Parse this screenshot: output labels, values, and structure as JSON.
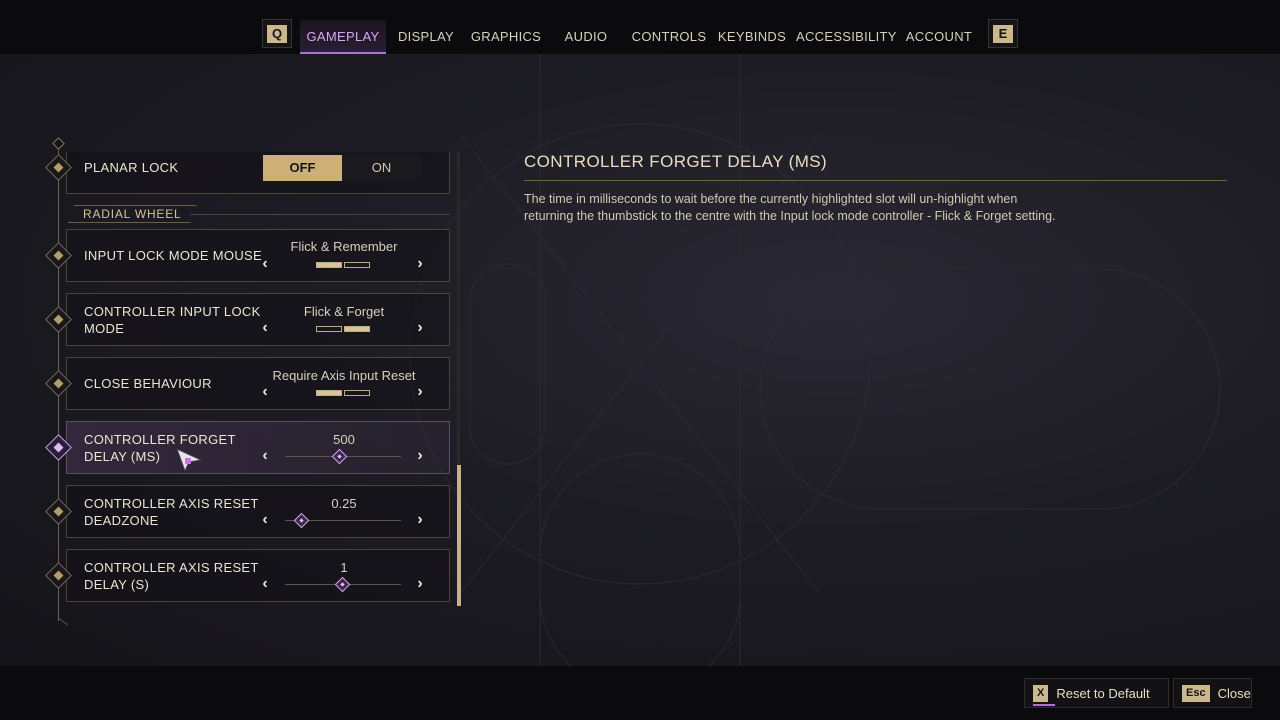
{
  "nav": {
    "prev_key": "Q",
    "next_key": "E",
    "tabs": [
      {
        "label": "GAMEPLAY",
        "active": true
      },
      {
        "label": "DISPLAY"
      },
      {
        "label": "GRAPHICS"
      },
      {
        "label": "AUDIO"
      },
      {
        "label": "CONTROLS"
      },
      {
        "label": "KEYBINDS"
      },
      {
        "label": "ACCESSIBILITY"
      },
      {
        "label": "ACCOUNT"
      }
    ]
  },
  "settings": {
    "planar_lock": {
      "label": "PLANAR LOCK",
      "off_label": "OFF",
      "on_label": "ON",
      "value": "OFF"
    },
    "section": "RADIAL WHEEL",
    "input_lock_mode_mouse": {
      "label": "INPUT LOCK MODE MOUSE",
      "value": "Flick & Remember",
      "option_index": 0,
      "option_count": 2
    },
    "controller_input_lock_mode": {
      "label_line1": "CONTROLLER INPUT LOCK",
      "label_line2": "MODE",
      "value": "Flick & Forget",
      "option_index": 1,
      "option_count": 2
    },
    "close_behaviour": {
      "label": "CLOSE BEHAVIOUR",
      "value": "Require Axis Input Reset",
      "option_index": 0,
      "option_count": 2
    },
    "controller_forget_delay": {
      "label_line1": "CONTROLLER FORGET",
      "label_line2": "DELAY (MS)",
      "value": "500",
      "slider_fraction": 0.47
    },
    "controller_axis_reset_deadzone": {
      "label_line1": "CONTROLLER AXIS RESET",
      "label_line2": "DEADZONE",
      "value": "0.25",
      "slider_fraction": 0.15
    },
    "controller_axis_reset_delay": {
      "label_line1": "CONTROLLER AXIS RESET",
      "label_line2": "DELAY (S)",
      "value": "1",
      "slider_fraction": 0.5
    }
  },
  "description": {
    "title": "CONTROLLER FORGET DELAY (MS)",
    "body": "The time in milliseconds to wait before the currently highlighted slot will un-highlight when returning the thumbstick to the centre with the Input lock mode controller - Flick & Forget setting."
  },
  "footer": {
    "reset_key": "X",
    "reset_label": "Reset to Default",
    "close_key": "Esc",
    "close_label": "Close"
  },
  "colors": {
    "accent_purple": "#b06fe0",
    "accent_gold": "#cdb078",
    "background": "#15141a"
  }
}
